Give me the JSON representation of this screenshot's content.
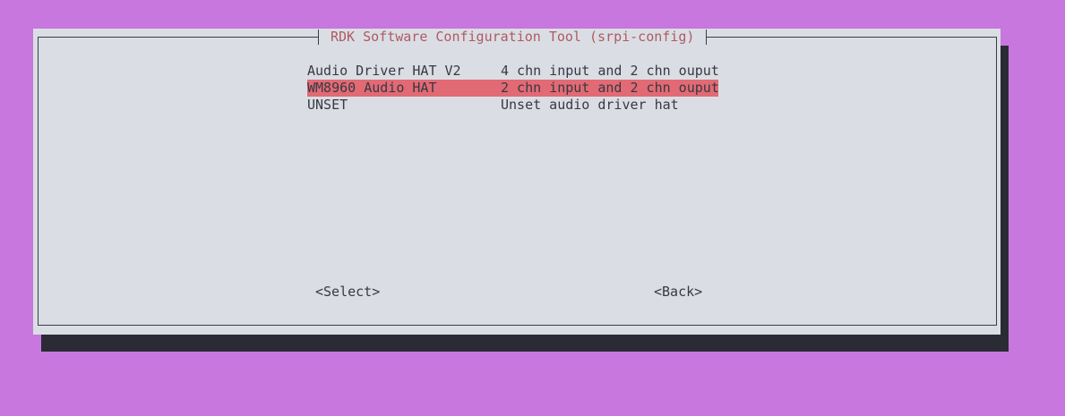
{
  "dialog": {
    "title": "RDK Software Configuration Tool (srpi-config)"
  },
  "menu": {
    "items": [
      {
        "name": "Audio Driver HAT V2",
        "description": "4 chn input and 2 chn ouput",
        "selected": false
      },
      {
        "name": "WM8960 Audio HAT",
        "description": "2 chn input and 2 chn ouput",
        "selected": true
      },
      {
        "name": "UNSET",
        "description": "Unset audio driver hat",
        "selected": false
      }
    ]
  },
  "buttons": {
    "select_label": "<Select>",
    "back_label": "<Back>"
  },
  "colors": {
    "background": "#c777dd",
    "dialog": "#dadee4",
    "highlight": "#e26a74",
    "title_text": "#b05a63",
    "shadow": "#2a2b35"
  }
}
